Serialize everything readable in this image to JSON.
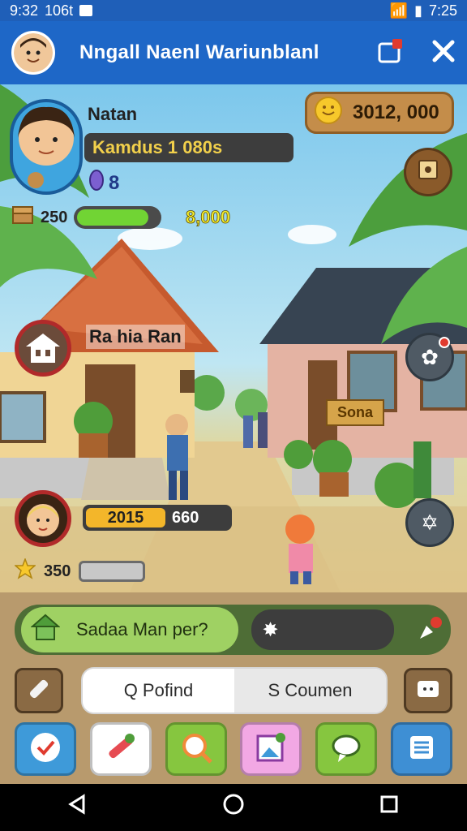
{
  "status_bar": {
    "time_left": "9:32",
    "carrier": "106t",
    "time_right": "7:25"
  },
  "header": {
    "title": "Nngall Naenl Wariunblanl"
  },
  "player": {
    "name": "Natan",
    "subtitle": "Kamdus 1 080s",
    "level_label": "8",
    "hp_label": "250",
    "hp_fill_pct": 88,
    "hp_value": "8,000"
  },
  "currency": {
    "amount": "3012, 000"
  },
  "npc": {
    "name": "Ra hia Ran",
    "quest_progress": "2015",
    "quest_value": "660",
    "stars": "350",
    "shop_sign": "Sona"
  },
  "chat": {
    "label": "Sadaa Man per?"
  },
  "tabs": [
    {
      "label": "Q Pofind"
    },
    {
      "label": "S Coumen"
    }
  ],
  "colors": {
    "header_bg": "#1e67c7",
    "hp_fill": "#71d434",
    "quest_fill": "#f3b62a",
    "chat_bg": "#9fd163"
  },
  "icons": [
    "gift-icon",
    "close-icon",
    "coin-icon",
    "map-icon",
    "house-icon",
    "star-icon",
    "compass-icon",
    "pencil-icon",
    "chat-icon",
    "checklist-icon",
    "search-icon",
    "back-icon",
    "home-icon",
    "recent-icon"
  ]
}
